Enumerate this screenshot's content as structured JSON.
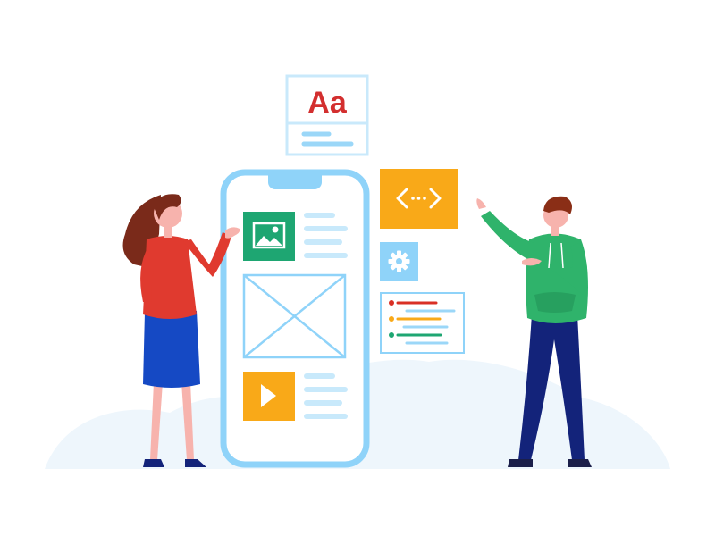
{
  "typography_card": {
    "sample_text": "Aa",
    "icon": "typography-card"
  },
  "icons": {
    "image": "image-icon",
    "play": "play-icon",
    "code": "code-icon",
    "settings": "gear-icon",
    "wireframe": "image-placeholder-icon"
  },
  "colors": {
    "background": "#ffffff",
    "backdrop": "#eaf4fb",
    "phone_frame": "#8fd3f9",
    "line_light": "#c8e9fb",
    "green": "#1ea672",
    "orange": "#f9a918",
    "red": "#d93025",
    "text_red": "#d32f2f",
    "woman_shirt": "#e03a2f",
    "woman_skirt": "#1549c4",
    "man_hoodie": "#2fb36b",
    "man_pants": "#13237a",
    "hair": "#7a2a1a",
    "skin": "#f7b3ad"
  }
}
